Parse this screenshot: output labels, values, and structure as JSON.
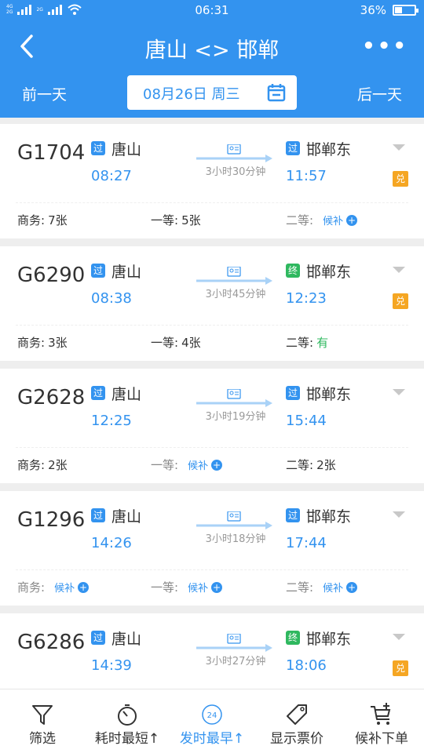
{
  "statusbar": {
    "net_top": "4G",
    "net_bottom": "2G",
    "net2_top": "2G",
    "net2_bottom": "",
    "time": "06:31",
    "battery": "36%"
  },
  "header": {
    "title": "唐山 <> 邯郸",
    "prev_day": "前一天",
    "next_day": "后一天",
    "date": "08月26日 周三"
  },
  "trains": [
    {
      "no": "G1704",
      "from_badge": "过",
      "from": "唐山",
      "dep": "08:27",
      "duration": "3小时30分钟",
      "to_badge": "过",
      "to": "邯郸东",
      "arr": "11:57",
      "dui": "兑",
      "seats": [
        {
          "label": "商务:",
          "value": "7张"
        },
        {
          "label": "一等:",
          "value": "5张"
        },
        {
          "label": "二等:",
          "value": "候补"
        }
      ]
    },
    {
      "no": "G6290",
      "from_badge": "过",
      "from": "唐山",
      "dep": "08:38",
      "duration": "3小时45分钟",
      "to_badge": "终",
      "to": "邯郸东",
      "arr": "12:23",
      "dui": "兑",
      "seats": [
        {
          "label": "商务:",
          "value": "3张"
        },
        {
          "label": "一等:",
          "value": "4张"
        },
        {
          "label": "二等:",
          "value": "有"
        }
      ]
    },
    {
      "no": "G2628",
      "from_badge": "过",
      "from": "唐山",
      "dep": "12:25",
      "duration": "3小时19分钟",
      "to_badge": "过",
      "to": "邯郸东",
      "arr": "15:44",
      "dui": "",
      "seats": [
        {
          "label": "商务:",
          "value": "2张"
        },
        {
          "label": "一等:",
          "value": "候补"
        },
        {
          "label": "二等:",
          "value": "2张"
        }
      ]
    },
    {
      "no": "G1296",
      "from_badge": "过",
      "from": "唐山",
      "dep": "14:26",
      "duration": "3小时18分钟",
      "to_badge": "过",
      "to": "邯郸东",
      "arr": "17:44",
      "dui": "",
      "seats": [
        {
          "label": "商务:",
          "value": "候补"
        },
        {
          "label": "一等:",
          "value": "候补"
        },
        {
          "label": "二等:",
          "value": "候补"
        }
      ]
    },
    {
      "no": "G6286",
      "from_badge": "过",
      "from": "唐山",
      "dep": "14:39",
      "duration": "3小时27分钟",
      "to_badge": "终",
      "to": "邯郸东",
      "arr": "18:06",
      "dui": "兑",
      "seats": []
    }
  ],
  "tabs": [
    {
      "label": "筛选",
      "icon": "filter-icon"
    },
    {
      "label": "耗时最短↑",
      "icon": "stopwatch-icon"
    },
    {
      "label": "发时最早↑",
      "icon": "clock-24-icon",
      "badge": "24"
    },
    {
      "label": "显示票价",
      "icon": "price-tag-icon"
    },
    {
      "label": "候补下单",
      "icon": "cart-add-icon"
    }
  ],
  "colors": {
    "primary": "#3393ef",
    "green": "#2fb85f",
    "orange": "#f5a623"
  }
}
